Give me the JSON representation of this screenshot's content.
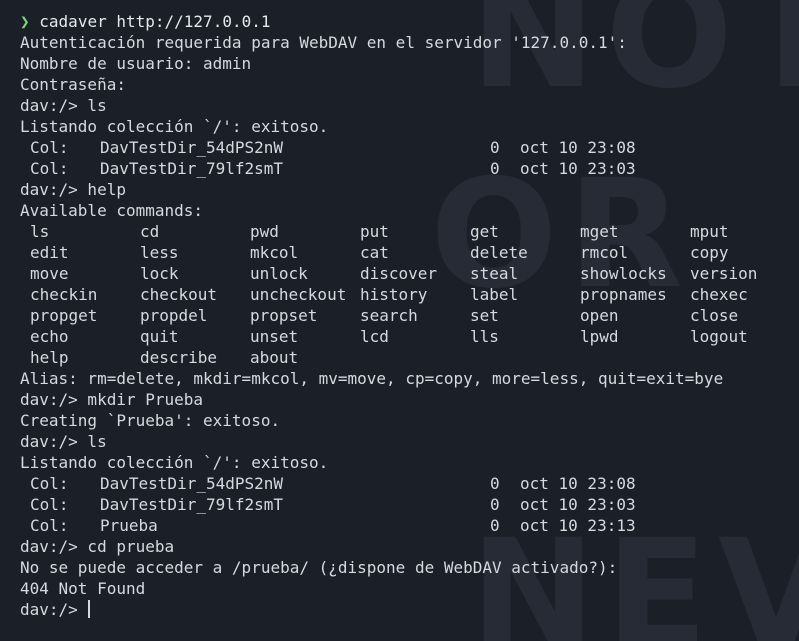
{
  "session": {
    "prompt_symbol": "❯",
    "command": "cadaver",
    "url": "http://127.0.0.1"
  },
  "auth": {
    "required_msg": "Autenticación requerida para WebDAV en el servidor '127.0.0.1':",
    "username_line": "Nombre de usuario: admin",
    "password_line": "Contraseña:"
  },
  "block1": {
    "prompt": "dav:/> ls",
    "listing_msg": "Listando colección `/': exitoso.",
    "rows": [
      {
        "type": "Col:",
        "name": "DavTestDir_54dPS2nW",
        "size": "0",
        "date": "oct 10 23:08"
      },
      {
        "type": "Col:",
        "name": "DavTestDir_79lf2smT",
        "size": "0",
        "date": "oct 10 23:03"
      }
    ]
  },
  "help": {
    "prompt": "dav:/> help",
    "title": "Available commands:",
    "commands": [
      "ls",
      "cd",
      "pwd",
      "put",
      "get",
      "mget",
      "mput",
      "edit",
      "less",
      "mkcol",
      "cat",
      "delete",
      "rmcol",
      "copy",
      "move",
      "lock",
      "unlock",
      "discover",
      "steal",
      "showlocks",
      "version",
      "checkin",
      "checkout",
      "uncheckout",
      "history",
      "label",
      "propnames",
      "chexec",
      "propget",
      "propdel",
      "propset",
      "search",
      "set",
      "open",
      "close",
      "echo",
      "quit",
      "unset",
      "lcd",
      "lls",
      "lpwd",
      "logout",
      "help",
      "describe",
      "about"
    ],
    "alias_line": "Alias: rm=delete, mkdir=mkcol, mv=move, cp=copy, more=less, quit=exit=bye"
  },
  "mkdir": {
    "prompt": "dav:/> mkdir Prueba",
    "result": "Creating `Prueba': exitoso."
  },
  "block2": {
    "prompt": "dav:/> ls",
    "listing_msg": "Listando colección `/': exitoso.",
    "rows": [
      {
        "type": "Col:",
        "name": "DavTestDir_54dPS2nW",
        "size": "0",
        "date": "oct 10 23:08"
      },
      {
        "type": "Col:",
        "name": "DavTestDir_79lf2smT",
        "size": "0",
        "date": "oct 10 23:03"
      },
      {
        "type": "Col:",
        "name": "Prueba",
        "size": "0",
        "date": "oct 10 23:13"
      }
    ]
  },
  "cd": {
    "prompt": "dav:/> cd prueba",
    "error": "No se puede acceder a /prueba/ (¿dispone de WebDAV activado?):",
    "status": "404 Not Found"
  },
  "final": {
    "prompt": "dav:/> "
  },
  "watermark": {
    "line1": "NOT",
    "line2": "OR",
    "line3": "NEV"
  }
}
